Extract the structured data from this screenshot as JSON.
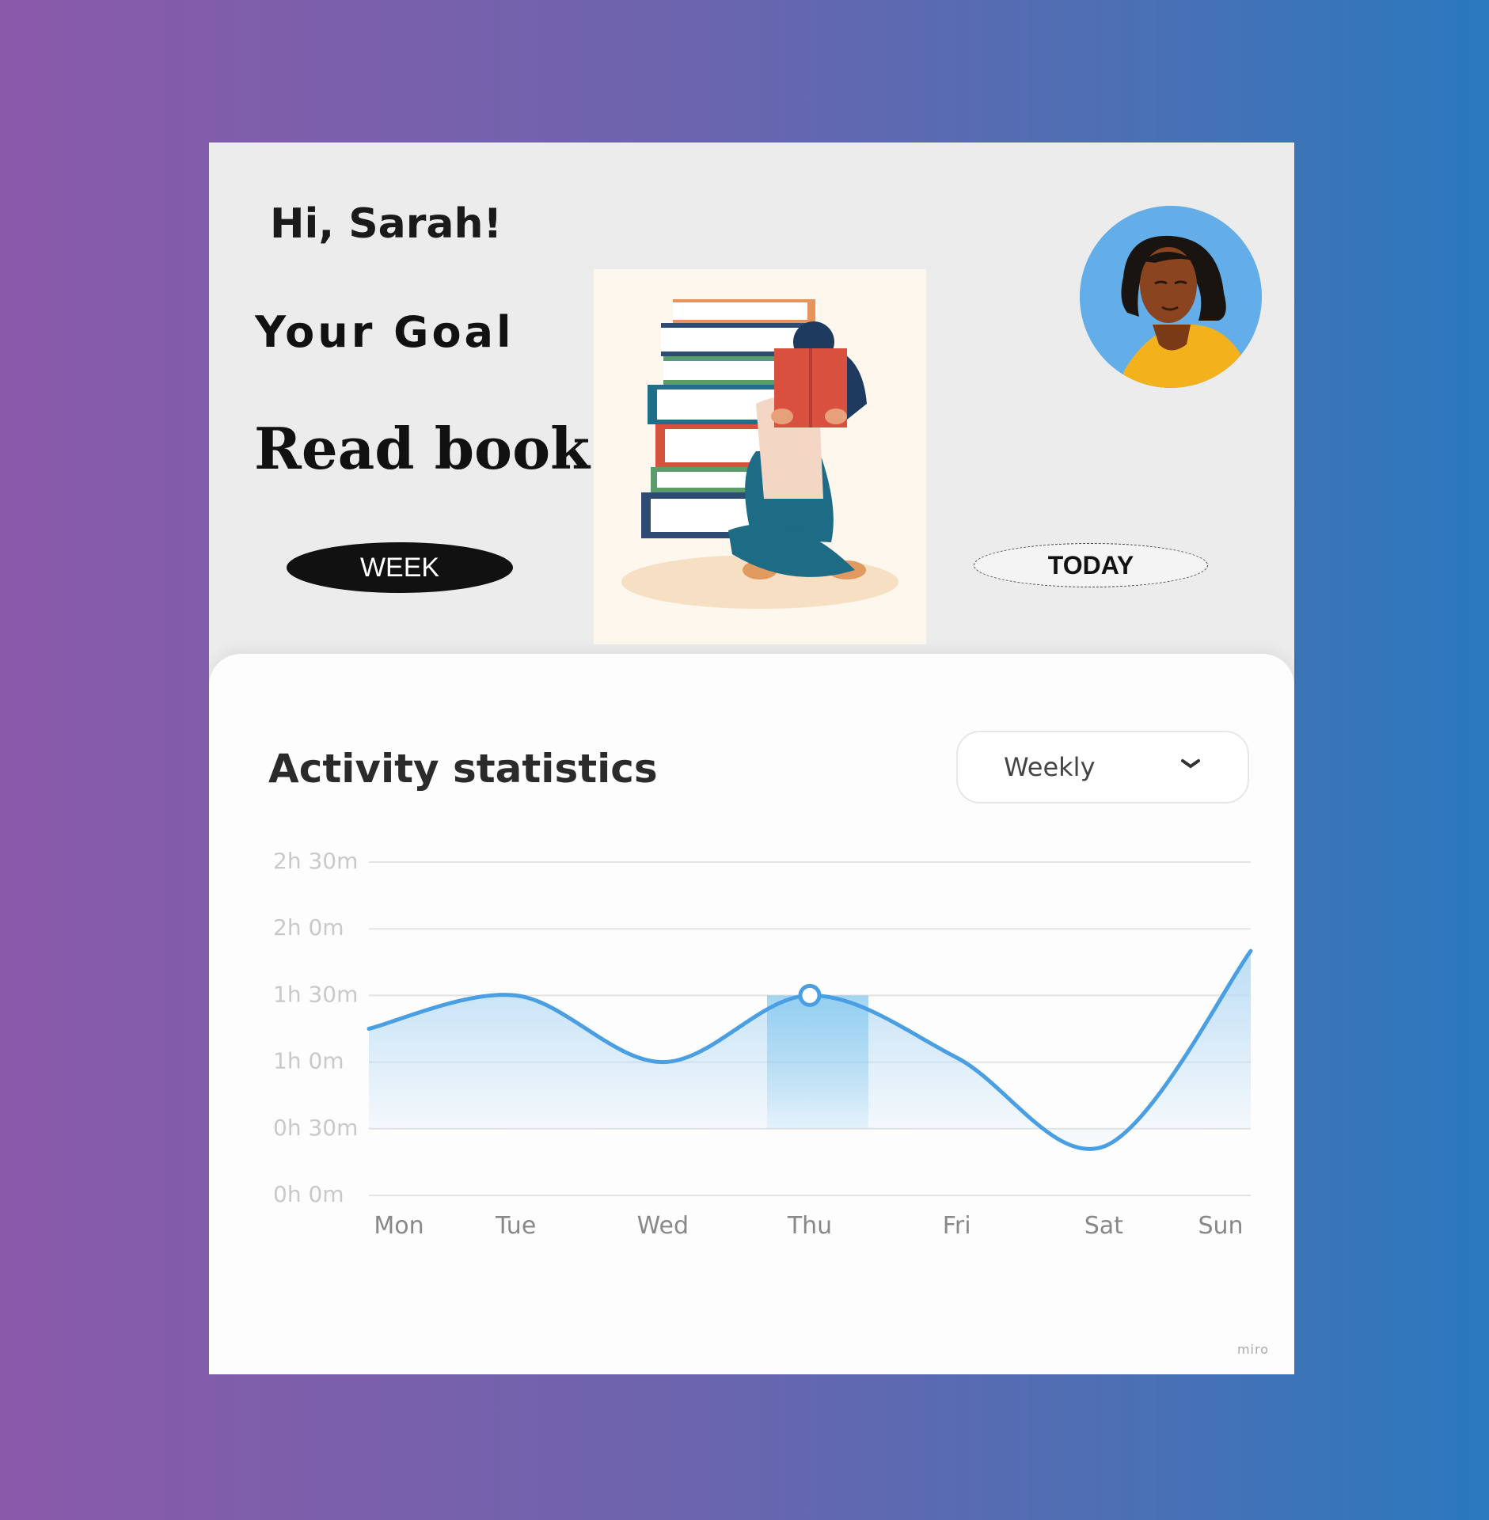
{
  "header": {
    "greeting": "Hi, Sarah!",
    "goal_label": "Your Goal",
    "goal_value": "Read book"
  },
  "buttons": {
    "week": "WEEK",
    "today": "TODAY"
  },
  "stats": {
    "title": "Activity statistics",
    "range_selected": "Weekly"
  },
  "watermark": "miro",
  "icons": [
    "chevron-down-icon",
    "avatar",
    "reading-illustration"
  ],
  "colors": {
    "line": "#4a9fe3",
    "fill": "#b9dcf5",
    "highlight": "#7fc6ef",
    "card": "#ececec",
    "panel": "#fdfdfd"
  },
  "chart_data": {
    "type": "area",
    "title": "Activity statistics",
    "categories": [
      "Mon",
      "Tue",
      "Wed",
      "Thu",
      "Fri",
      "Sat",
      "Sun"
    ],
    "y_tick_labels": [
      "0h 0m",
      "0h 30m",
      "1h 0m",
      "1h 30m",
      "2h 0m",
      "2h 30m"
    ],
    "ylim": [
      0,
      150
    ],
    "y_unit": "minutes",
    "series": [
      {
        "values": [
          75,
          90,
          60,
          90,
          62,
          22,
          110
        ]
      }
    ],
    "highlight_category": "Thu",
    "grid": true
  }
}
